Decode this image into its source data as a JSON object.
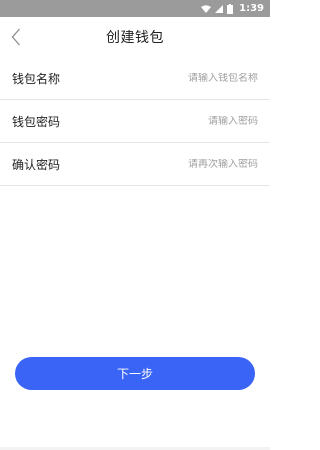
{
  "status_bar": {
    "time": "1:39",
    "icons": [
      "wifi-icon",
      "signal-icon",
      "battery-icon"
    ]
  },
  "header": {
    "title": "创建钱包",
    "back_icon": "chevron-left-icon"
  },
  "form": {
    "fields": [
      {
        "label": "钱包名称",
        "placeholder": "请输入钱包名称",
        "value": ""
      },
      {
        "label": "钱包密码",
        "placeholder": "请输入密码",
        "value": ""
      },
      {
        "label": "确认密码",
        "placeholder": "请再次输入密码",
        "value": ""
      }
    ]
  },
  "actions": {
    "next_label": "下一步"
  },
  "colors": {
    "accent": "#3a64f5",
    "status_bar": "#9b9b9b",
    "divider": "#e6e6e6",
    "placeholder": "#a0a0a0"
  }
}
